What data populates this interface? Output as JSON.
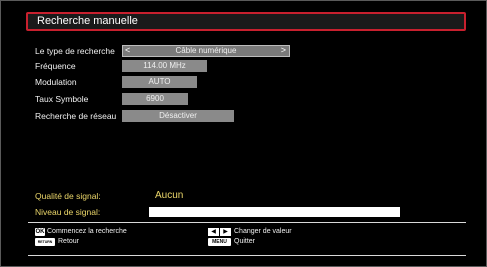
{
  "title": "Recherche manuelle",
  "rows": [
    {
      "label": "Le type de recherche",
      "value": "Câble numérique",
      "prev": "<",
      "next": ">"
    },
    {
      "label": "Fréquence",
      "value": "114.00 MHz"
    },
    {
      "label": "Modulation",
      "value": "AUTO"
    },
    {
      "label": "Taux Symbole",
      "value": "6900"
    },
    {
      "label": "Recherche de réseau",
      "value": "Désactiver"
    }
  ],
  "signal": {
    "quality_label": "Qualité de signal:",
    "quality_value": "Aucun",
    "level_label": "Niveau de signal:"
  },
  "footer": {
    "ok_key": "OK",
    "ok_text": "Commencez la recherche",
    "return_key": "RETURN",
    "return_text": "Retour",
    "arrow_left": "◀",
    "arrow_right": "▶",
    "change_text": "Changer de valeur",
    "menu_key": "MENU",
    "menu_text": "Quitter"
  },
  "colors": {
    "accent_border": "#c8202e",
    "label_yellow": "#ecd76a",
    "value_bg": "#8a8a8a"
  }
}
